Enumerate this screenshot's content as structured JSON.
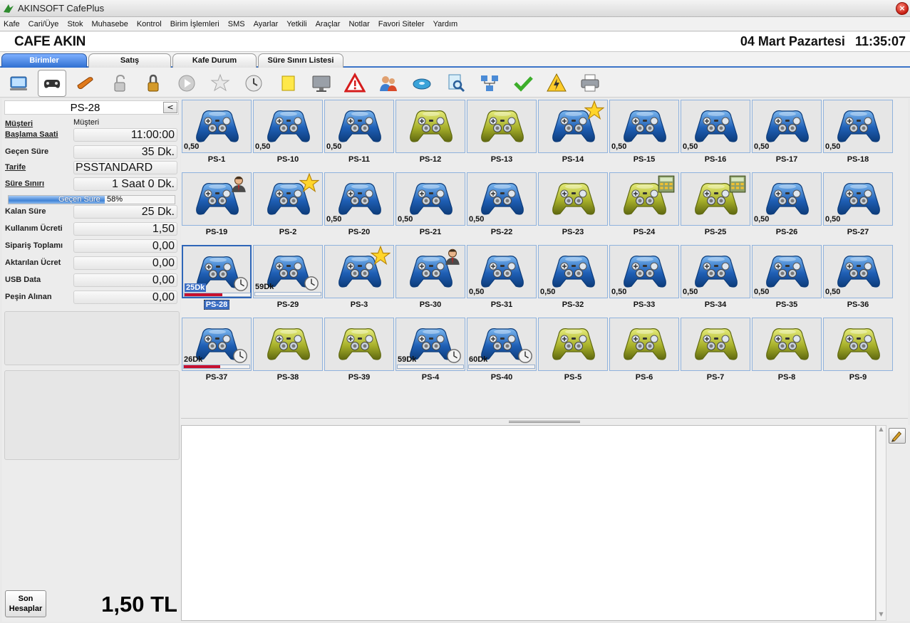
{
  "app": {
    "title": "AKINSOFT CafePlus"
  },
  "menu": [
    "Kafe",
    "Cari/Üye",
    "Stok",
    "Muhasebe",
    "Kontrol",
    "Birim İşlemleri",
    "SMS",
    "Ayarlar",
    "Yetkili",
    "Araçlar",
    "Notlar",
    "Favori Siteler",
    "Yardım"
  ],
  "header": {
    "cafe_name": "CAFE AKIN",
    "date": "04 Mart Pazartesi",
    "time": "11:35:07"
  },
  "tabs": [
    "Birimler",
    "Satış",
    "Kafe Durum",
    "Süre Sınırı Listesi"
  ],
  "toolbar": [
    "monitor-icon",
    "gamepad-icon",
    "pencil-icon",
    "unlock-icon",
    "lock-icon",
    "play-icon",
    "star-icon",
    "clock-icon",
    "note-icon",
    "display-icon",
    "warning-icon",
    "users-icon",
    "disk-icon",
    "search-icon",
    "network-icon",
    "check-icon",
    "alert-bolt-icon",
    "printer-icon"
  ],
  "unit": {
    "name": "PS-28",
    "collapse_label": "<",
    "rows": [
      {
        "label": "Müşteri",
        "value": "Müşteri"
      },
      {
        "label": "Başlama Saati",
        "value": "11:00:00"
      },
      {
        "label": "Geçen Süre",
        "value": "35 Dk."
      },
      {
        "label": "Tarife",
        "value": "PSSTANDARD"
      },
      {
        "label": "Süre Sınırı",
        "value": "1 Saat 0 Dk."
      }
    ],
    "progress": {
      "label": "Geçen Süre",
      "percent_text": "58%",
      "percent": 58
    },
    "rows2": [
      {
        "label": "Kalan Süre",
        "value": "25 Dk."
      },
      {
        "label": "Kullanım Ücreti",
        "value": "1,50"
      },
      {
        "label": "Sipariş Toplamı",
        "value": "0,00"
      },
      {
        "label": "Aktarılan Ücret",
        "value": "0,00"
      },
      {
        "label": "USB Data",
        "value": "0,00"
      },
      {
        "label": "Peşin Alınan",
        "value": "0,00"
      }
    ]
  },
  "footer": {
    "son_line1": "Son",
    "son_line2": "Hesaplar",
    "total": "1,50 TL"
  },
  "colors": {
    "blue_pad": "#2b6cc4",
    "yellow_pad": "#b8c23a",
    "selection": "#2e66b8",
    "bar_red": "#c8102e"
  },
  "units": [
    {
      "name": "PS-1",
      "color": "blue",
      "price": "0,50"
    },
    {
      "name": "PS-10",
      "color": "blue",
      "price": "0,50"
    },
    {
      "name": "PS-11",
      "color": "blue",
      "price": "0,50"
    },
    {
      "name": "PS-12",
      "color": "yellow"
    },
    {
      "name": "PS-13",
      "color": "yellow"
    },
    {
      "name": "PS-14",
      "color": "blue",
      "badge": "star"
    },
    {
      "name": "PS-15",
      "color": "blue",
      "price": "0,50"
    },
    {
      "name": "PS-16",
      "color": "blue",
      "price": "0,50"
    },
    {
      "name": "PS-17",
      "color": "blue",
      "price": "0,50"
    },
    {
      "name": "PS-18",
      "color": "blue",
      "price": "0,50"
    },
    {
      "name": "PS-19",
      "color": "blue",
      "badge": "person"
    },
    {
      "name": "PS-2",
      "color": "blue",
      "badge": "star"
    },
    {
      "name": "PS-20",
      "color": "blue",
      "price": "0,50"
    },
    {
      "name": "PS-21",
      "color": "blue",
      "price": "0,50"
    },
    {
      "name": "PS-22",
      "color": "blue",
      "price": "0,50"
    },
    {
      "name": "PS-23",
      "color": "yellow"
    },
    {
      "name": "PS-24",
      "color": "yellow",
      "badge": "calc"
    },
    {
      "name": "PS-25",
      "color": "yellow",
      "badge": "calc"
    },
    {
      "name": "PS-26",
      "color": "blue",
      "price": "0,50"
    },
    {
      "name": "PS-27",
      "color": "blue",
      "price": "0,50"
    },
    {
      "name": "PS-28",
      "color": "blue",
      "badge": "clock",
      "remaining": "25Dk",
      "bar": 0.58,
      "bar_color": "red",
      "selected": true
    },
    {
      "name": "PS-29",
      "color": "blue",
      "badge": "clock",
      "remaining": "59Dk",
      "bar": 0
    },
    {
      "name": "PS-3",
      "color": "blue",
      "badge": "star"
    },
    {
      "name": "PS-30",
      "color": "blue",
      "badge": "person"
    },
    {
      "name": "PS-31",
      "color": "blue",
      "price": "0,50"
    },
    {
      "name": "PS-32",
      "color": "blue",
      "price": "0,50"
    },
    {
      "name": "PS-33",
      "color": "blue",
      "price": "0,50"
    },
    {
      "name": "PS-34",
      "color": "blue",
      "price": "0,50"
    },
    {
      "name": "PS-35",
      "color": "blue",
      "price": "0,50"
    },
    {
      "name": "PS-36",
      "color": "blue",
      "price": "0,50"
    },
    {
      "name": "PS-37",
      "color": "blue",
      "badge": "clock",
      "remaining": "26Dk",
      "bar": 0.55,
      "bar_color": "red"
    },
    {
      "name": "PS-38",
      "color": "yellow"
    },
    {
      "name": "PS-39",
      "color": "yellow"
    },
    {
      "name": "PS-4",
      "color": "blue",
      "badge": "clock",
      "remaining": "59Dk",
      "bar": 0
    },
    {
      "name": "PS-40",
      "color": "blue",
      "badge": "clock",
      "remaining": "60Dk",
      "bar": 0
    },
    {
      "name": "PS-5",
      "color": "yellow"
    },
    {
      "name": "PS-6",
      "color": "yellow"
    },
    {
      "name": "PS-7",
      "color": "yellow"
    },
    {
      "name": "PS-8",
      "color": "yellow"
    },
    {
      "name": "PS-9",
      "color": "yellow"
    }
  ]
}
